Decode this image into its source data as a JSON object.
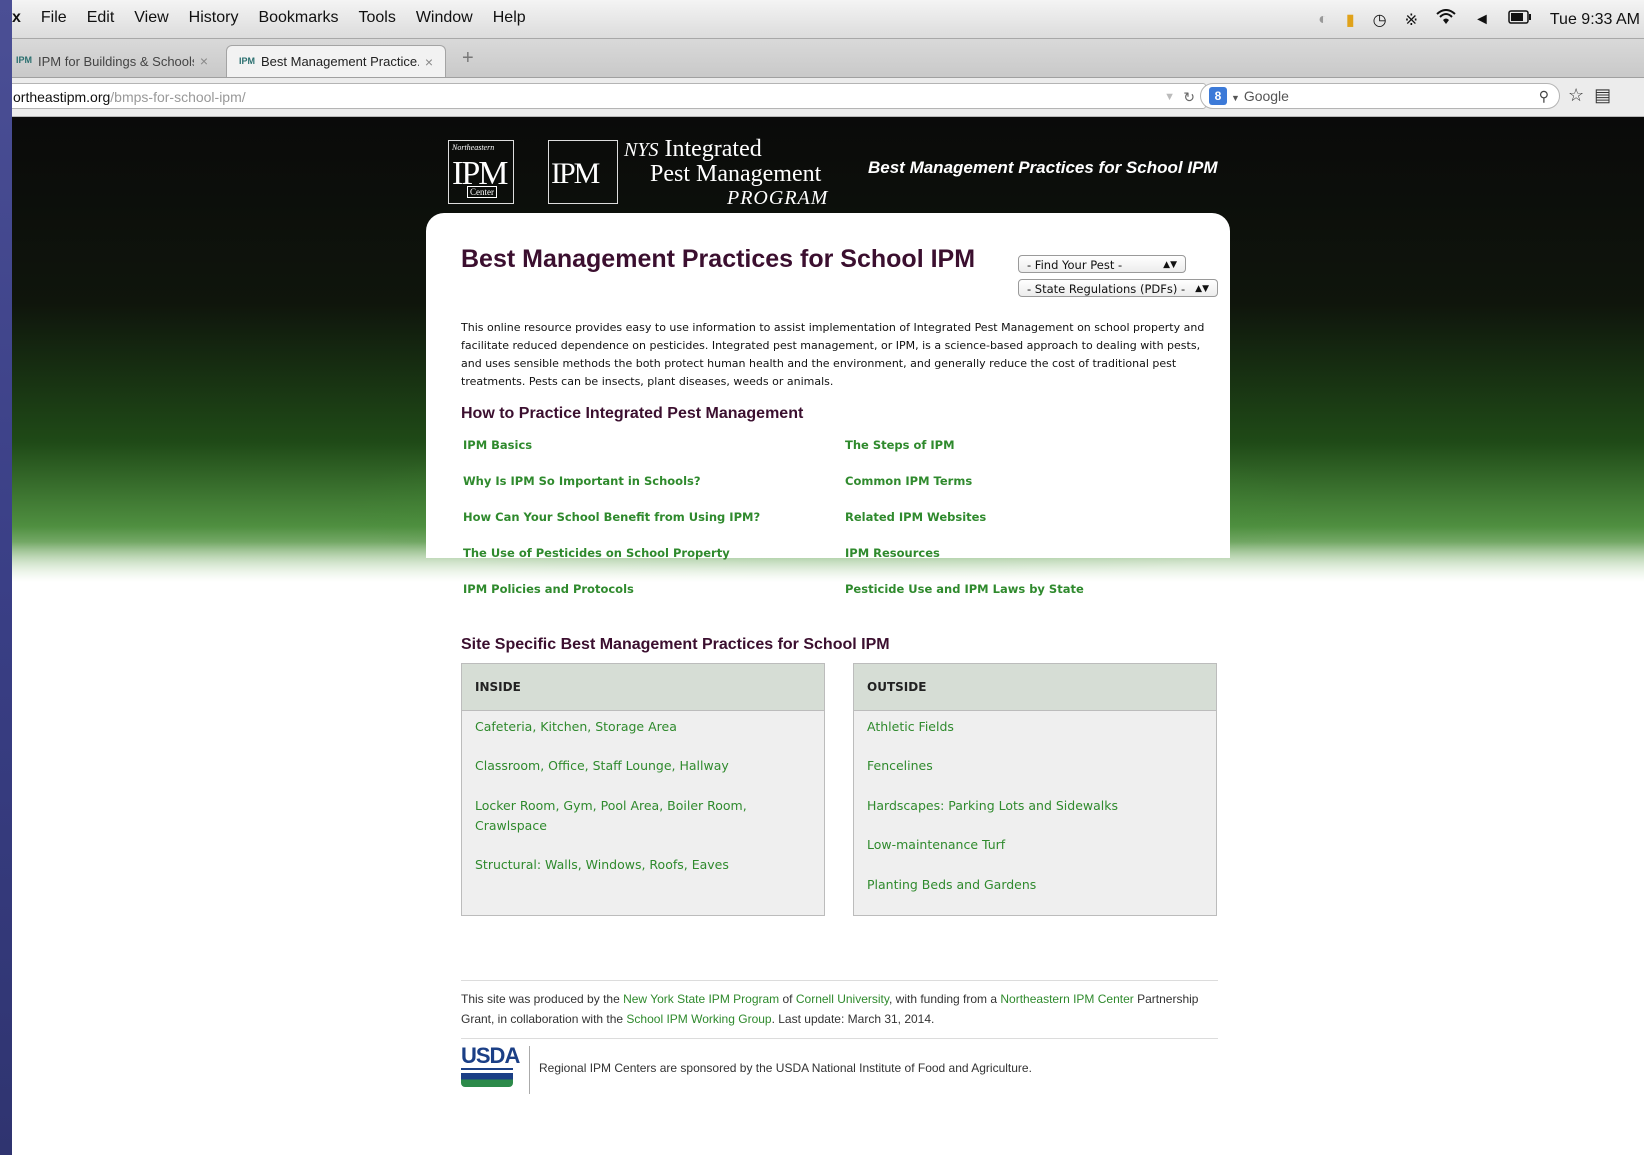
{
  "menubar": {
    "app_fragment": "x",
    "menus": [
      "File",
      "Edit",
      "View",
      "History",
      "Bookmarks",
      "Tools",
      "Window",
      "Help"
    ],
    "clock": "Tue 9:33 AM"
  },
  "tabs": [
    {
      "favicon": "IPM",
      "title": "IPM for Buildings & Schools",
      "active": false
    },
    {
      "favicon": "IPM",
      "title": "Best Management Practice...",
      "active": true
    }
  ],
  "navbar": {
    "url_host": "ortheastipm.org",
    "url_path": "/bmps-for-school-ipm/",
    "search_placeholder": "Google"
  },
  "header": {
    "ne_logo_small": "Northeastern",
    "ne_logo_big": "IPM",
    "ne_logo_center": "Center",
    "nys_logo_big": "IPM",
    "nys_line1_italic": "NYS",
    "nys_line1": " Integrated",
    "nys_line2": "Pest Management",
    "nys_line3": "PROGRAM",
    "tagline": "Best Management Practices for School IPM"
  },
  "main": {
    "title": "Best Management Practices for School IPM",
    "find_pest_select": "- Find Your Pest -",
    "state_regs_select": "- State Regulations (PDFs) -",
    "intro": "This online resource provides easy to use information to assist implementation of Integrated Pest Management on school property and facilitate reduced dependence on pesticides. Integrated pest management, or IPM, is a science-based approach to dealing with pests, and uses sensible methods the both protect human health and the environment, and generally reduce the cost of traditional pest treatments. Pests can be insects, plant diseases, weeds or animals.",
    "how_heading": "How to Practice Integrated Pest Management",
    "how_links_left": [
      "IPM Basics",
      "Why Is IPM So Important in Schools?",
      "How Can Your School Benefit from Using IPM?",
      "The Use of Pesticides on School Property",
      "IPM Policies and Protocols"
    ],
    "how_links_right": [
      "The Steps of IPM",
      "Common IPM Terms",
      "Related IPM Websites",
      "IPM Resources",
      "Pesticide Use and IPM Laws by State"
    ],
    "site_heading": "Site Specific Best Management Practices for School IPM",
    "inside": {
      "header": "INSIDE",
      "items": [
        "Cafeteria, Kitchen, Storage Area",
        "Classroom, Office, Staff Lounge, Hallway",
        "Locker Room, Gym, Pool Area, Boiler Room, Crawlspace",
        "Structural: Walls, Windows, Roofs, Eaves"
      ]
    },
    "outside": {
      "header": "OUTSIDE",
      "items": [
        "Athletic Fields",
        "Fencelines",
        "Hardscapes: Parking Lots and Sidewalks",
        "Low-maintenance Turf",
        "Planting Beds and Gardens"
      ]
    }
  },
  "footer": {
    "t1": "This site was produced by the ",
    "l1": "New York State IPM Program",
    "t2": " of ",
    "l2": "Cornell University",
    "t3": ", with funding from a ",
    "l3": "Northeastern IPM Center",
    "t4": " Partnership Grant, in collaboration with the ",
    "l4": "School IPM Working Group",
    "t5": ". Last update: March 31, 2014.",
    "usda_logo": "USDA",
    "sponsor": "Regional IPM Centers are sponsored by the USDA National Institute of Food and Agriculture."
  },
  "colors": {
    "link_green": "#2f8a2d",
    "heading_plum": "#3b0f2f"
  }
}
